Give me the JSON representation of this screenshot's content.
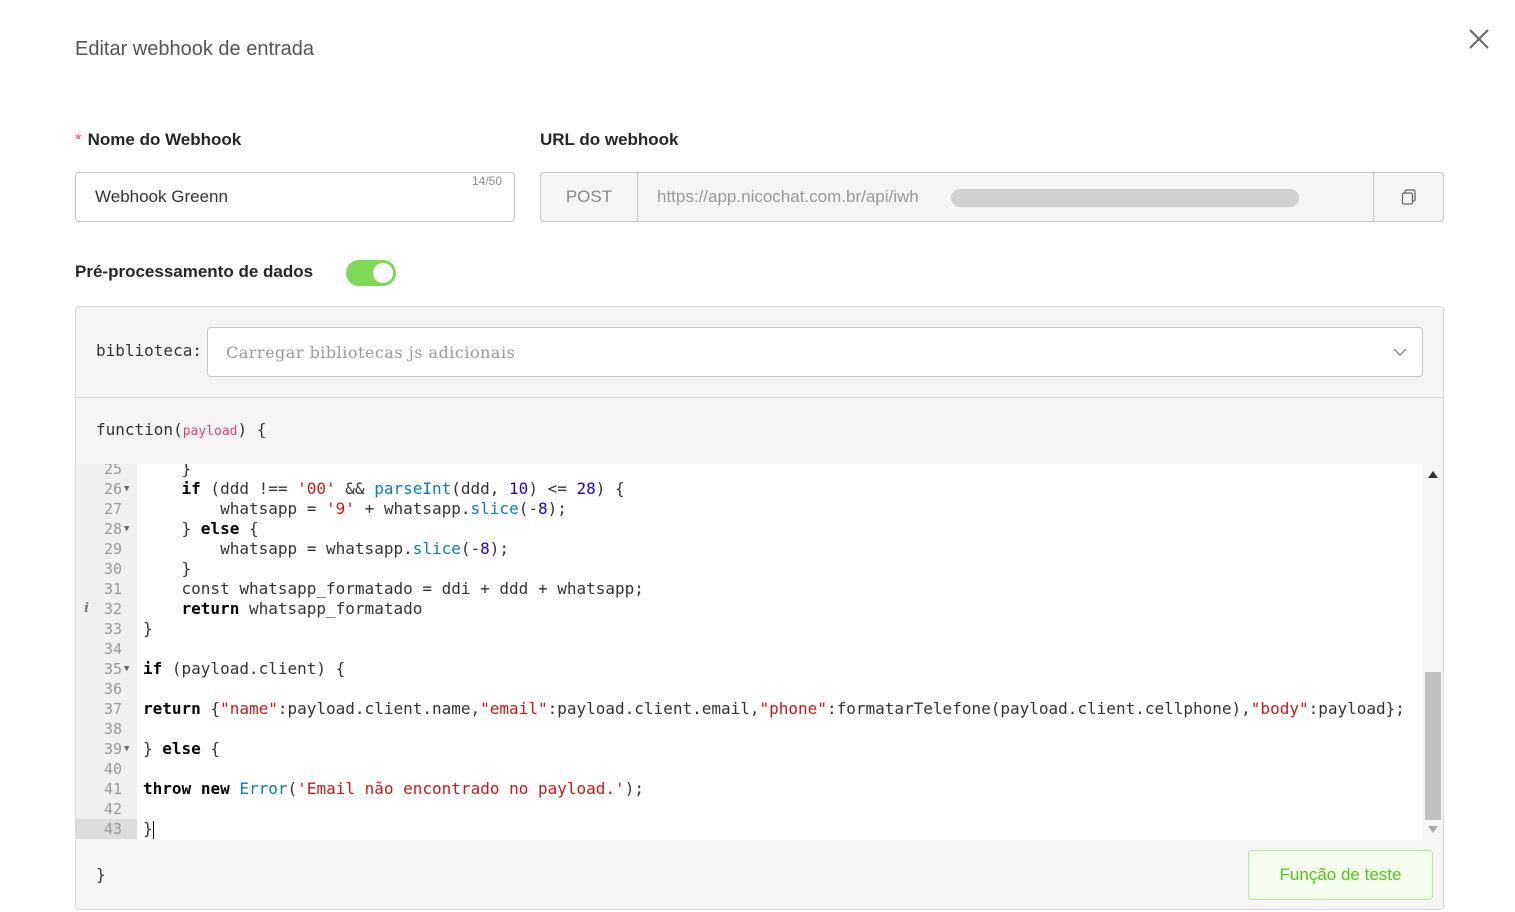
{
  "modal": {
    "title": "Editar webhook de entrada"
  },
  "name_field": {
    "label": "Nome do Webhook",
    "required_mark": "*",
    "value": "Webhook Greenn",
    "counter": "14/50"
  },
  "url_field": {
    "label": "URL do webhook",
    "method": "POST",
    "value": "https://app.nicochat.com.br/api/iwh"
  },
  "preprocessing": {
    "label": "Pré-processamento de dados",
    "enabled": true
  },
  "library": {
    "label": "biblioteca:",
    "placeholder": "Carregar bibliotecas js adicionais"
  },
  "function_wrapper": {
    "head_keyword": "function(",
    "head_param": "payload",
    "head_close": ") {",
    "tail": "}"
  },
  "editor": {
    "lines": [
      {
        "n": "25",
        "fold": false,
        "info": false,
        "html": "    }"
      },
      {
        "n": "26",
        "fold": true,
        "info": false,
        "html": "    <span class=\"kw\">if</span> (ddd !== <span class=\"str\">'00'</span> && <span class=\"fnc\">parseInt</span>(ddd, <span class=\"num\">10</span>) <= <span class=\"num\">28</span>) {"
      },
      {
        "n": "27",
        "fold": false,
        "info": false,
        "html": "        whatsapp = <span class=\"str\">'9'</span> + whatsapp.<span class=\"fnc\">slice</span>(-<span class=\"num\">8</span>);"
      },
      {
        "n": "28",
        "fold": true,
        "info": false,
        "html": "    } <span class=\"kw\">else</span> {"
      },
      {
        "n": "29",
        "fold": false,
        "info": false,
        "html": "        whatsapp = whatsapp.<span class=\"fnc\">slice</span>(-<span class=\"num\">8</span>);"
      },
      {
        "n": "30",
        "fold": false,
        "info": false,
        "html": "    }"
      },
      {
        "n": "31",
        "fold": false,
        "info": false,
        "html": "    const whatsapp_formatado = ddi + ddd + whatsapp;"
      },
      {
        "n": "32",
        "fold": false,
        "info": true,
        "html": "    <span class=\"kw\">return</span> whatsapp_formatado"
      },
      {
        "n": "33",
        "fold": false,
        "info": false,
        "html": "}"
      },
      {
        "n": "34",
        "fold": false,
        "info": false,
        "html": ""
      },
      {
        "n": "35",
        "fold": true,
        "info": false,
        "html": "<span class=\"kw\">if</span> (payload.client) {"
      },
      {
        "n": "36",
        "fold": false,
        "info": false,
        "html": ""
      },
      {
        "n": "37",
        "fold": false,
        "info": false,
        "html": "<span class=\"kw\">return</span> {<span class=\"str\">\"name\"</span>:payload.client.name,<span class=\"str\">\"email\"</span>:payload.client.email,<span class=\"str\">\"phone\"</span>:formatarTelefone(payload.client.cellphone),<span class=\"str\">\"body\"</span>:payload};"
      },
      {
        "n": "38",
        "fold": false,
        "info": false,
        "html": ""
      },
      {
        "n": "39",
        "fold": true,
        "info": false,
        "html": "} <span class=\"kw\">else</span> {"
      },
      {
        "n": "40",
        "fold": false,
        "info": false,
        "html": ""
      },
      {
        "n": "41",
        "fold": false,
        "info": false,
        "html": "<span class=\"kw\">throw</span> <span class=\"kw\">new</span> <span class=\"cls\">Error</span>(<span class=\"str\">'Email não encontrado no payload.'</span>);"
      },
      {
        "n": "42",
        "fold": false,
        "info": false,
        "html": ""
      },
      {
        "n": "43",
        "fold": false,
        "info": false,
        "active": true,
        "html": "}<span class=\"cursor\"></span>"
      }
    ]
  },
  "test_button": {
    "label": "Função de teste"
  },
  "colors": {
    "toggle_on": "#7ed957",
    "required": "#ff4d4f",
    "test_button_text": "#52c41a",
    "string": "#c41a16",
    "number": "#1c00cf",
    "function": "#0b7ab7"
  },
  "icons": {
    "close": "close-icon",
    "copy": "copy-icon",
    "dropdown": "chevron-down-icon",
    "fold": "fold-arrow-icon",
    "info": "info-icon"
  }
}
